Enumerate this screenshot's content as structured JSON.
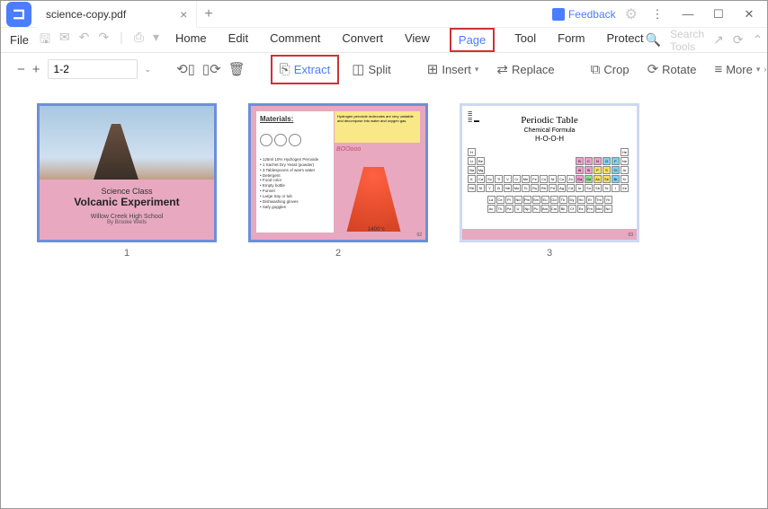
{
  "titlebar": {
    "document_name": "science-copy.pdf",
    "feedback_label": "Feedback"
  },
  "menubar": {
    "file_label": "File",
    "items": [
      "Home",
      "Edit",
      "Comment",
      "Convert",
      "View",
      "Page",
      "Tool",
      "Form",
      "Protect"
    ],
    "search_placeholder": "Search Tools"
  },
  "toolbar": {
    "page_range": "1-2",
    "extract_label": "Extract",
    "split_label": "Split",
    "insert_label": "Insert",
    "replace_label": "Replace",
    "crop_label": "Crop",
    "rotate_label": "Rotate",
    "more_label": "More"
  },
  "pages": [
    {
      "num": "1",
      "slide": {
        "line1": "Science Class",
        "line2": "Volcanic Experiment",
        "line3": "Willow Creek High School",
        "line4": "By Brooke Wells"
      }
    },
    {
      "num": "2",
      "slide": {
        "materials_title": "Materials:",
        "materials": "• 125ml 10% Hydrogen Peroxide\n• 1 Sachet Dry Yeast (powder)\n• 3 Tablespoons of warm water\n• Detergent\n• Food color\n• Empty bottle\n• Funnel\n• Large tray or tub\n• Dishwashing gloves\n• Safy goggles",
        "boom": "BOOooo",
        "temp": "1400°c",
        "page_corner": "02"
      }
    },
    {
      "num": "3",
      "slide": {
        "title": "Periodic Table",
        "subtitle": "Chemical Formula",
        "formula": "H-O-O-H",
        "page_corner": "03"
      }
    }
  ]
}
